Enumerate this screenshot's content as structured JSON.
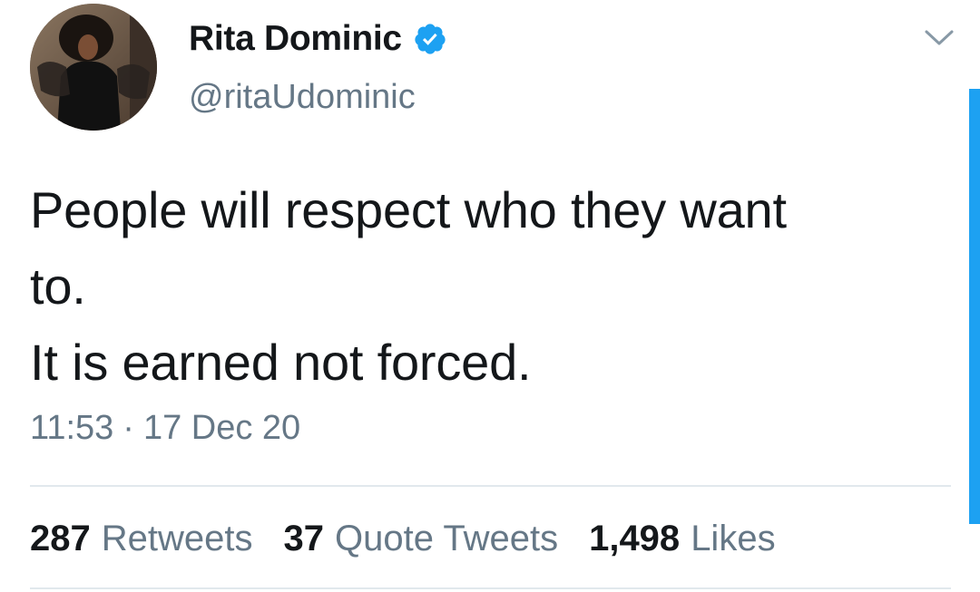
{
  "author": {
    "display_name": "Rita Dominic",
    "handle": "@ritaUdominic",
    "verified": true,
    "avatar_icon": "profile-photo"
  },
  "tweet": {
    "lines": [
      "People will respect who they want",
      "to.",
      "It is earned not forced."
    ],
    "time": "11:53",
    "separator": "·",
    "date": "17 Dec 20"
  },
  "stats": {
    "retweets": {
      "count": "287",
      "label": "Retweets"
    },
    "quote_tweets": {
      "count": "37",
      "label": "Quote Tweets"
    },
    "likes": {
      "count": "1,498",
      "label": "Likes"
    }
  },
  "colors": {
    "accent": "#1da1f2",
    "text_primary": "#14171a",
    "text_secondary": "#657786",
    "divider": "#e1e8ed"
  },
  "icons": {
    "verified": "verified-badge-icon",
    "menu": "chevron-down-icon"
  }
}
